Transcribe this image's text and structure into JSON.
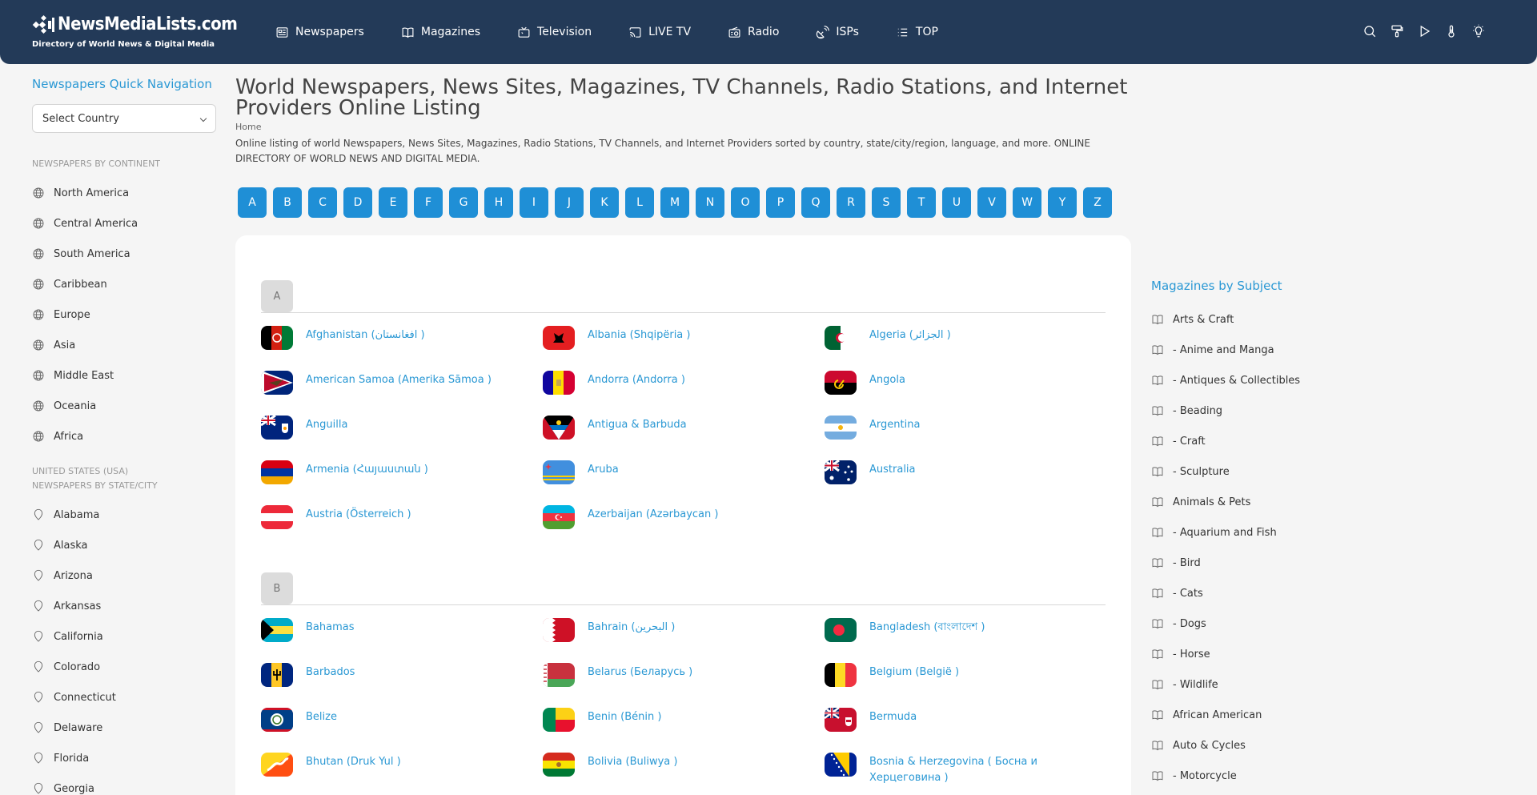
{
  "header": {
    "logo_title": "NewsMediaLists.com",
    "logo_subtitle": "Directory of World News & Digital Media",
    "nav": [
      {
        "label": "Newspapers",
        "icon": "newspaper-icon"
      },
      {
        "label": "Magazines",
        "icon": "book-icon"
      },
      {
        "label": "Television",
        "icon": "tv-icon"
      },
      {
        "label": "LIVE TV",
        "icon": "cast-icon"
      },
      {
        "label": "Radio",
        "icon": "radio-icon"
      },
      {
        "label": "ISPs",
        "icon": "satellite-icon"
      },
      {
        "label": "TOP",
        "icon": "list-icon"
      }
    ],
    "tools": [
      "search-icon",
      "paint-roller-icon",
      "play-icon",
      "thermometer-icon",
      "bulb-icon"
    ]
  },
  "left": {
    "quick_nav_title": "Newspapers Quick Navigation",
    "select_value": "Select Country",
    "continents_label": "NEWSPAPERS BY CONTINENT",
    "continents": [
      "North America",
      "Central America",
      "South America",
      "Caribbean",
      "Europe",
      "Asia",
      "Middle East",
      "Oceania",
      "Africa"
    ],
    "usa_label_1": "UNITED STATES (USA)",
    "usa_label_2": "NEWSPAPERS BY STATE/CITY",
    "states": [
      "Alabama",
      "Alaska",
      "Arizona",
      "Arkansas",
      "California",
      "Colorado",
      "Connecticut",
      "Delaware",
      "Florida",
      "Georgia"
    ]
  },
  "main": {
    "title": "World Newspapers, News Sites, Magazines, TV Channels, Radio Stations, and Internet Providers Online Listing",
    "breadcrumb": "Home",
    "description": "Online listing of world Newspapers, News Sites, Magazines, Radio Stations, TV Channels, and Internet Providers sorted by country, state/city/region, language, and more. ONLINE DIRECTORY OF WORLD NEWS AND DIGITAL MEDIA.",
    "alphabet": [
      "A",
      "B",
      "C",
      "D",
      "E",
      "F",
      "G",
      "H",
      "I",
      "J",
      "K",
      "L",
      "M",
      "N",
      "O",
      "P",
      "Q",
      "R",
      "S",
      "T",
      "U",
      "V",
      "W",
      "Y",
      "Z"
    ],
    "groups": [
      {
        "letter": "A",
        "countries": [
          {
            "name": "Afghanistan (افغانستان )",
            "flag": "af"
          },
          {
            "name": "Albania (Shqipëria )",
            "flag": "al"
          },
          {
            "name": "Algeria (الجزائر )",
            "flag": "dz"
          },
          {
            "name": "American Samoa (Amerika Sāmoa )",
            "flag": "as"
          },
          {
            "name": "Andorra (Andorra )",
            "flag": "ad"
          },
          {
            "name": "Angola",
            "flag": "ao"
          },
          {
            "name": "Anguilla",
            "flag": "ai"
          },
          {
            "name": "Antigua & Barbuda",
            "flag": "ag"
          },
          {
            "name": "Argentina",
            "flag": "ar"
          },
          {
            "name": "Armenia (Հայաստան )",
            "flag": "am"
          },
          {
            "name": "Aruba",
            "flag": "aw"
          },
          {
            "name": "Australia",
            "flag": "au"
          },
          {
            "name": "Austria (Österreich )",
            "flag": "at"
          },
          {
            "name": "Azerbaijan (Azərbaycan )",
            "flag": "az"
          }
        ]
      },
      {
        "letter": "B",
        "countries": [
          {
            "name": "Bahamas",
            "flag": "bs"
          },
          {
            "name": "Bahrain (البحرين )",
            "flag": "bh"
          },
          {
            "name": "Bangladesh (বাংলাদেশ )",
            "flag": "bd"
          },
          {
            "name": "Barbados",
            "flag": "bb"
          },
          {
            "name": "Belarus (Беларусь )",
            "flag": "by"
          },
          {
            "name": "Belgium (België )",
            "flag": "be"
          },
          {
            "name": "Belize",
            "flag": "bz"
          },
          {
            "name": "Benin (Bénin )",
            "flag": "bj"
          },
          {
            "name": "Bermuda",
            "flag": "bm"
          },
          {
            "name": "Bhutan (Druk Yul )",
            "flag": "bt"
          },
          {
            "name": "Bolivia (Buliwya )",
            "flag": "bo"
          },
          {
            "name": "Bosnia & Herzegovina ( Босна и Херцеговина )",
            "flag": "ba"
          }
        ]
      }
    ]
  },
  "right": {
    "title": "Magazines by Subject",
    "subjects": [
      "Arts & Craft",
      "- Anime and Manga",
      "- Antiques & Collectibles",
      "- Beading",
      "- Craft",
      "- Sculpture",
      "Animals & Pets",
      "- Aquarium and Fish",
      "- Bird",
      "- Cats",
      "- Dogs",
      "- Horse",
      "- Wildlife",
      "African American",
      "Auto & Cycles",
      "- Motorcycle"
    ]
  },
  "colors": {
    "header_bg": "#233a58",
    "accent": "#2a98d4",
    "letter_button": "#1f8fd6"
  }
}
